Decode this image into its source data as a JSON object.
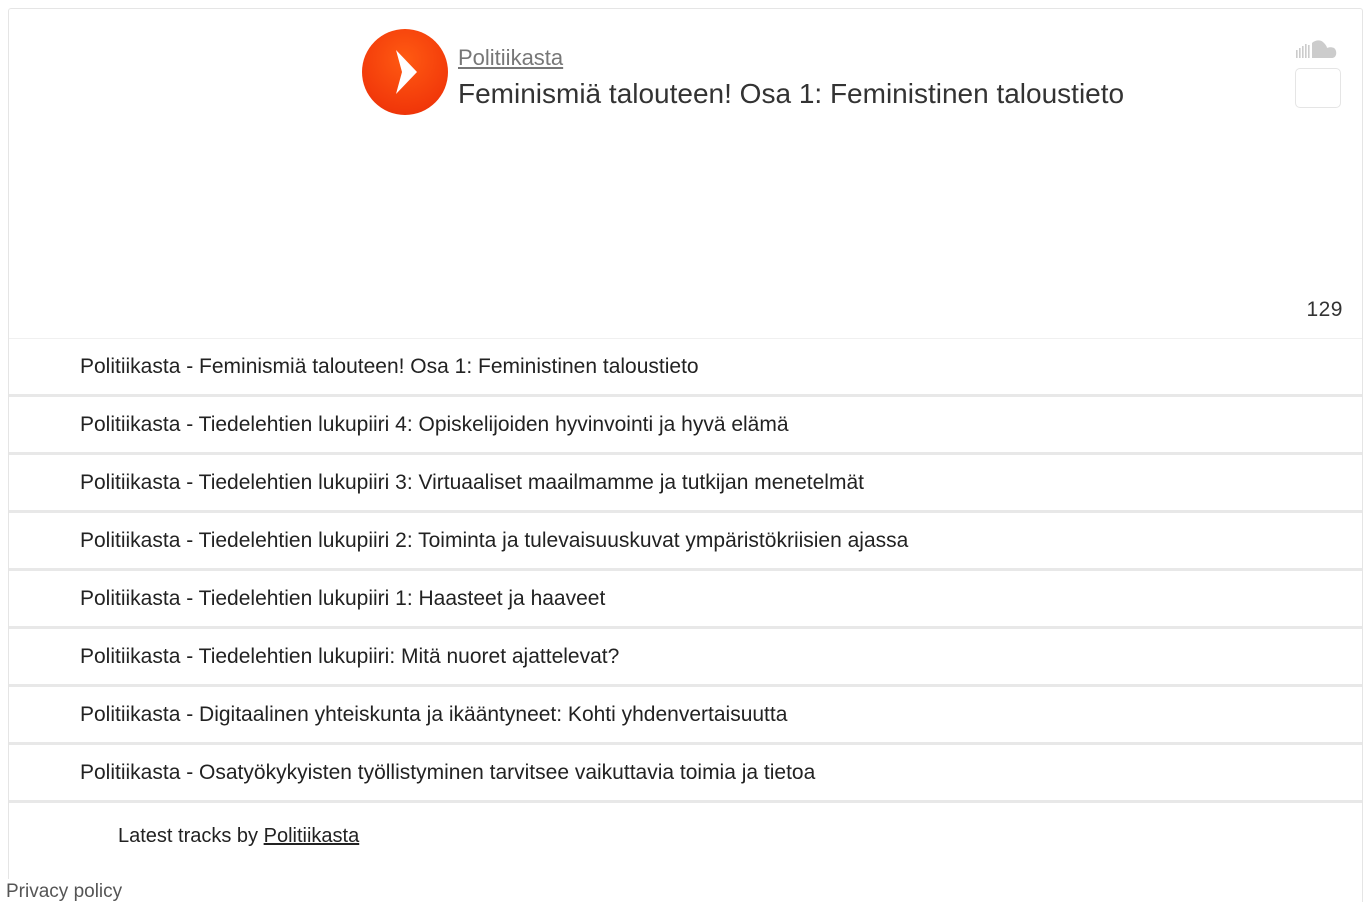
{
  "player": {
    "artist": "Politiikasta",
    "title": "Feminismiä talouteen! Osa 1: Feministinen taloustieto",
    "play_count": "129",
    "play_icon": "play-icon",
    "logo_icon": "soundcloud-logo-icon",
    "accent_color": "#f2390a"
  },
  "tracks": [
    "Politiikasta - Feminismiä talouteen! Osa 1: Feministinen taloustieto",
    "Politiikasta - Tiedelehtien lukupiiri 4: Opiskelijoiden hyvinvointi ja hyvä elämä",
    "Politiikasta - Tiedelehtien lukupiiri 3: Virtuaaliset maailmamme ja tutkijan menetelmät",
    "Politiikasta - Tiedelehtien lukupiiri 2: Toiminta ja tulevaisuuskuvat ympäristökriisien ajassa",
    "Politiikasta - Tiedelehtien lukupiiri 1: Haasteet ja haaveet",
    "Politiikasta - Tiedelehtien lukupiiri: Mitä nuoret ajattelevat?",
    "Politiikasta - Digitaalinen yhteiskunta ja ikääntyneet: Kohti yhdenvertaisuutta",
    "Politiikasta - Osatyökykyisten työllistyminen tarvitsee vaikuttavia toimia ja tietoa"
  ],
  "footer": {
    "latest_prefix": "Latest tracks by ",
    "latest_artist": "Politiikasta",
    "privacy": "Privacy policy"
  }
}
